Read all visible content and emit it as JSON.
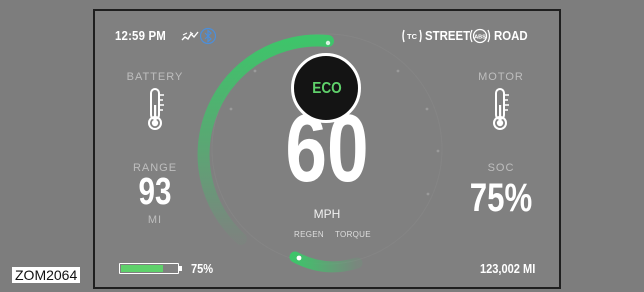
{
  "status_bar": {
    "time": "12:59 PM",
    "street_label": "STREET",
    "road_label": "ROAD",
    "tc_icon_text": "TC",
    "abs_icon_text": "ABS"
  },
  "drive_mode": {
    "label": "ECO"
  },
  "speed": {
    "value": "60",
    "unit": "MPH"
  },
  "mode_labels": {
    "regen": "REGEN",
    "torque": "TORQUE"
  },
  "battery": {
    "label": "BATTERY"
  },
  "motor": {
    "label": "MOTOR"
  },
  "range": {
    "label": "RANGE",
    "value": "93",
    "unit": "MI"
  },
  "soc": {
    "label": "SOC",
    "value": "75%"
  },
  "battery_level": {
    "percent_label": "75%",
    "fraction": 0.75
  },
  "odometer": {
    "value": "123,002 MI"
  },
  "figure_caption": "ZOM2064",
  "colors": {
    "accent_green": "#5fd16b",
    "arc_green": "#3ec46a",
    "screen_bg": "#808080"
  }
}
